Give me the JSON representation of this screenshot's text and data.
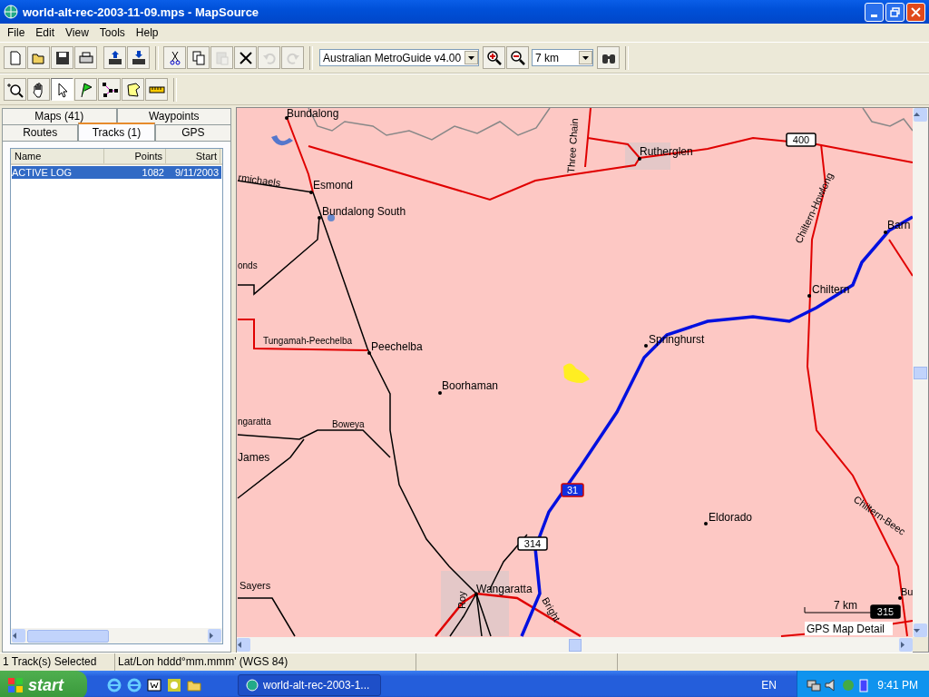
{
  "window": {
    "title": "world-alt-rec-2003-11-09.mps - MapSource"
  },
  "menu": [
    "File",
    "Edit",
    "View",
    "Tools",
    "Help"
  ],
  "toolbar_main": {
    "file_buttons": [
      {
        "kind": "new",
        "disabled": false
      },
      {
        "kind": "open",
        "disabled": false
      },
      {
        "kind": "save",
        "disabled": false
      },
      {
        "kind": "print",
        "disabled": false
      },
      {
        "kind": "send",
        "disabled": false
      },
      {
        "kind": "receive",
        "disabled": false
      }
    ],
    "edit_buttons": [
      {
        "kind": "cut",
        "disabled": false
      },
      {
        "kind": "copy",
        "disabled": false
      },
      {
        "kind": "paste",
        "disabled": true
      },
      {
        "kind": "delete",
        "disabled": false
      },
      {
        "kind": "undo",
        "disabled": true
      },
      {
        "kind": "redo",
        "disabled": true
      }
    ],
    "map_product": {
      "value": "Australian MetroGuide v4.00"
    },
    "zoom_buttons": [
      {
        "kind": "zoom-in",
        "disabled": false
      },
      {
        "kind": "zoom-out",
        "disabled": false
      }
    ],
    "zoom_scale": {
      "value": "7 km"
    }
  },
  "toolbar_tools": [
    {
      "kind": "zoom",
      "selected": false
    },
    {
      "kind": "hand",
      "selected": false
    },
    {
      "kind": "select",
      "selected": true
    },
    {
      "kind": "flag",
      "selected": false
    },
    {
      "kind": "route",
      "selected": false
    },
    {
      "kind": "area",
      "selected": false
    },
    {
      "kind": "ruler",
      "selected": false
    }
  ],
  "tabs": [
    [
      {
        "label": "Maps (41)",
        "selected": false
      },
      {
        "label": "Waypoints",
        "selected": false
      }
    ],
    [
      {
        "label": "Routes",
        "selected": false
      },
      {
        "label": "Tracks (1)",
        "selected": true
      },
      {
        "label": "GPS",
        "selected": false
      }
    ]
  ],
  "table": {
    "columns": [
      "Name",
      "Points",
      "Start"
    ],
    "rows": [
      {
        "name": "ACTIVE LOG",
        "points": "1082",
        "start": "9/11/2003",
        "selected": true
      }
    ]
  },
  "map": {
    "labels": [
      "Bundalong",
      "Rutherglen",
      "rmichaels",
      "Esmond",
      "Bundalong South",
      "onds",
      "Tungamah-Peechelba",
      "Peechelba",
      "Springhurst",
      "Chiltern",
      "Barn",
      "Boorhaman",
      "ngaratta",
      "Boweya",
      "James",
      "Eldorado",
      "Sayers",
      "Wangaratta",
      "Bu",
      "Three Chain",
      "Chiltern-Howlong",
      "Chiltern-Beec",
      "Roy",
      "Bright"
    ],
    "shields": [
      {
        "label": "400",
        "kind": "white"
      },
      {
        "label": "31",
        "kind": "freeway"
      },
      {
        "label": "314",
        "kind": "white"
      },
      {
        "label": "315",
        "kind": "black"
      }
    ],
    "scale": "7 km",
    "detail": "GPS Map Detail"
  },
  "status_bar": [
    "1 Track(s) Selected",
    "Lat/Lon hddd°mm.mmm' (WGS 84)"
  ],
  "taskbar": {
    "start": "start",
    "quick_launch": [
      {
        "kind": "ie"
      },
      {
        "kind": "ie"
      },
      {
        "kind": "media"
      },
      {
        "kind": "clock"
      },
      {
        "kind": "folder"
      }
    ],
    "task": "world-alt-rec-2003-1...",
    "language": "EN",
    "time": "9:41 PM"
  }
}
